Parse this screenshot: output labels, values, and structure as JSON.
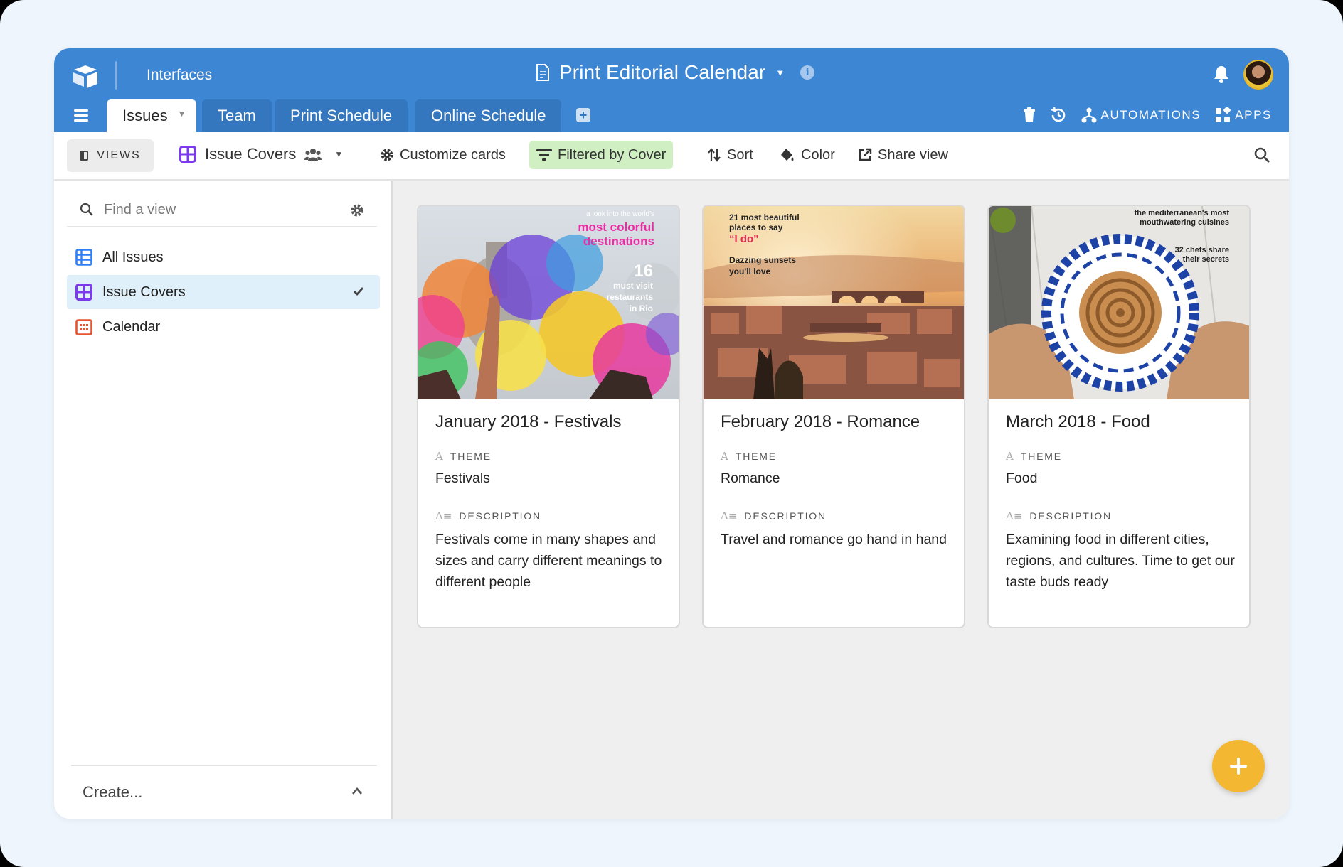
{
  "header": {
    "interfaces_label": "Interfaces",
    "base_title": "Print Editorial Calendar"
  },
  "tabs": [
    {
      "label": "Issues",
      "active": true
    },
    {
      "label": "Team"
    },
    {
      "label": "Print Schedule"
    },
    {
      "label": "Online Schedule"
    }
  ],
  "top_actions": {
    "automations_label": "AUTOMATIONS",
    "apps_label": "APPS"
  },
  "toolbar": {
    "views_label": "VIEWS",
    "current_view": "Issue Covers",
    "customize_label": "Customize cards",
    "filter_label": "Filtered by Cover",
    "sort_label": "Sort",
    "color_label": "Color",
    "share_label": "Share view"
  },
  "sidebar": {
    "find_placeholder": "Find a view",
    "views": [
      {
        "label": "All Issues",
        "icon": "grid-icon",
        "color": "#2d7ff9"
      },
      {
        "label": "Issue Covers",
        "icon": "gallery-icon",
        "color": "#7c39ed",
        "selected": true
      },
      {
        "label": "Calendar",
        "icon": "calendar-icon",
        "color": "#e8552c"
      }
    ],
    "create_label": "Create..."
  },
  "cards": [
    {
      "title": "January 2018 - Festivals",
      "theme_label": "THEME",
      "theme": "Festivals",
      "description_label": "DESCRIPTION",
      "description": "Festivals come in many shapes and sizes and carry different meanings to different people",
      "cover": {
        "line1": "a look into the world's",
        "line2": "most colorful",
        "line3": "destinations",
        "number": "16",
        "line4": "must visit",
        "line5": "restaurants",
        "line6": "in Rio"
      }
    },
    {
      "title": "February 2018 - Romance",
      "theme_label": "THEME",
      "theme": "Romance",
      "description_label": "DESCRIPTION",
      "description": "Travel and romance go hand in hand",
      "cover": {
        "line1": "21 most beautiful",
        "line2": "places to say",
        "line3": "“I do”",
        "line4": "Dazzing sunsets",
        "line5": "you'll love"
      }
    },
    {
      "title": "March 2018 - Food",
      "theme_label": "THEME",
      "theme": "Food",
      "description_label": "DESCRIPTION",
      "description": "Examining food in different cities, regions, and cultures. Time to get our taste buds ready",
      "cover": {
        "line1": "the mediterranean's most",
        "line2": "mouthwatering cuisines",
        "line3": "32 chefs share",
        "line4": "their secrets"
      }
    }
  ],
  "colors": {
    "header_blue": "#3c86d4",
    "tab_blue": "#3577be",
    "filter_green": "#d0f0c4",
    "fab_yellow": "#f4b731",
    "selected_view": "#e0f0fa"
  }
}
